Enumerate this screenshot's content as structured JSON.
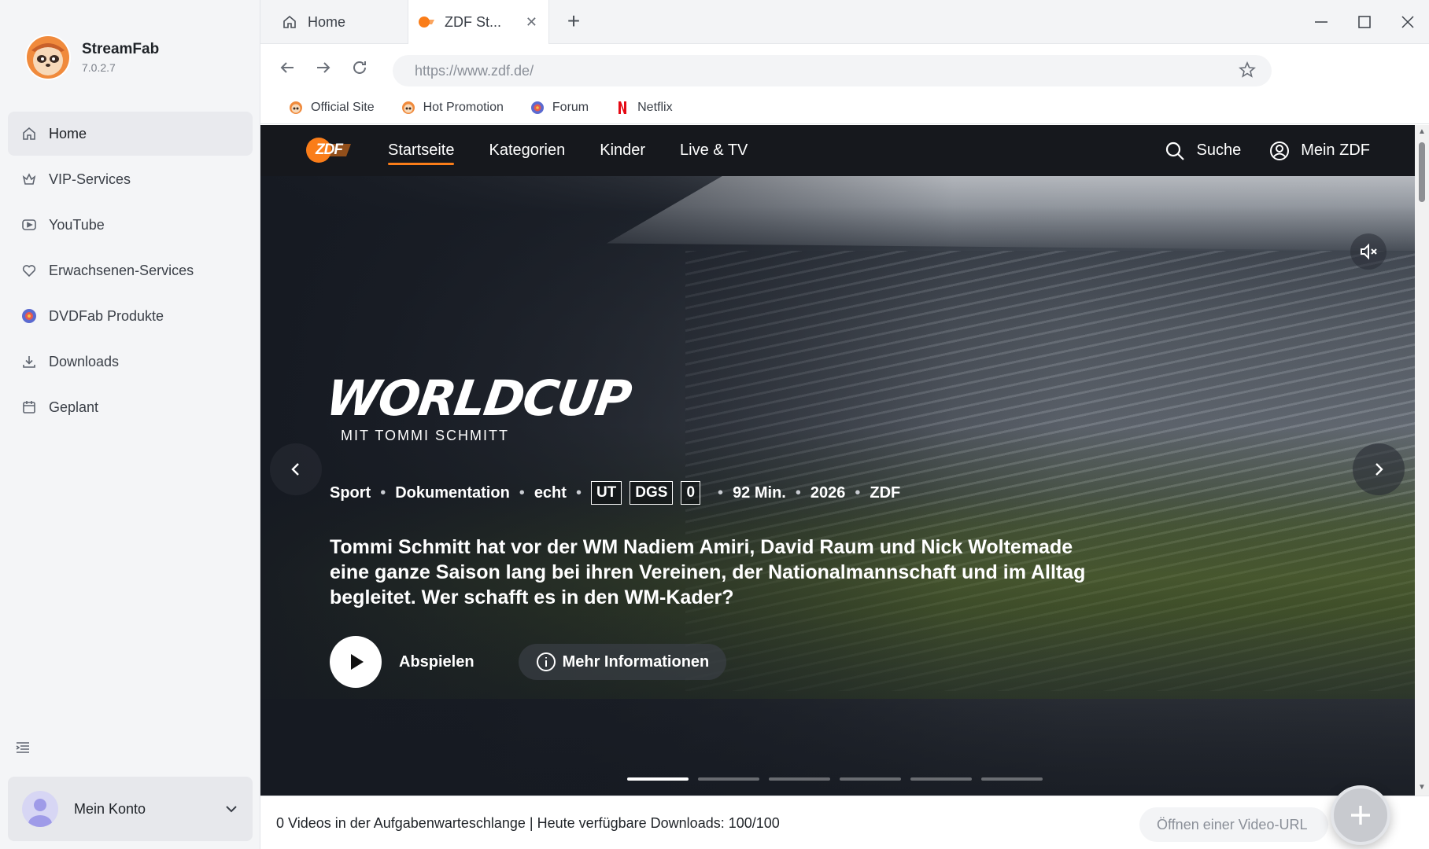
{
  "app": {
    "name": "StreamFab",
    "version": "7.0.2.7"
  },
  "sidebar": {
    "items": [
      {
        "label": "Home",
        "icon": "home-icon",
        "active": true
      },
      {
        "label": "VIP-Services",
        "icon": "vip-icon"
      },
      {
        "label": "YouTube",
        "icon": "youtube-icon"
      },
      {
        "label": "Erwachsenen-Services",
        "icon": "heart-icon"
      },
      {
        "label": "DVDFab Produkte",
        "icon": "dvdfab-icon"
      },
      {
        "label": "Downloads",
        "icon": "download-icon"
      },
      {
        "label": "Geplant",
        "icon": "calendar-icon"
      }
    ],
    "account_label": "Mein Konto"
  },
  "tabs": [
    {
      "label": "Home",
      "icon": "home-icon"
    },
    {
      "label": "ZDF St...",
      "icon": "zdf-icon",
      "active": true
    }
  ],
  "toolbar": {
    "url": "https://www.zdf.de/"
  },
  "bookmarks": [
    {
      "label": "Official Site",
      "icon": "streamfab-icon"
    },
    {
      "label": "Hot Promotion",
      "icon": "streamfab-icon"
    },
    {
      "label": "Forum",
      "icon": "dvdfab-icon"
    },
    {
      "label": "Netflix",
      "icon": "netflix-icon"
    }
  ],
  "zdf": {
    "logo_text": "ZDF",
    "nav": [
      {
        "label": "Startseite",
        "active": true
      },
      {
        "label": "Kategorien"
      },
      {
        "label": "Kinder"
      },
      {
        "label": "Live & TV"
      }
    ],
    "search_label": "Suche",
    "account_label": "Mein ZDF",
    "hero": {
      "logo_title": "WORLDCUP",
      "logo_subtitle": "MIT TOMMI SCHMITT",
      "meta": {
        "genre": "Sport",
        "type": "Dokumentation",
        "tag": "echt",
        "badges": [
          "UT",
          "DGS",
          "0"
        ],
        "duration": "92 Min.",
        "year": "2026",
        "channel": "ZDF"
      },
      "description": "Tommi Schmitt hat vor der WM Nadiem Amiri, David Raum und Nick Woltemade eine ganze Saison lang bei ihren Vereinen, der Nationalmannschaft und im Alltag begleitet. Wer schafft es in den WM-Kader?",
      "play_label": "Abspielen",
      "info_label": "Mehr Informationen",
      "slide_count": 6,
      "active_slide": 1
    },
    "accent_color": "#fa7d19"
  },
  "statusbar": {
    "queue_text": "0 Videos in der Aufgabenwarteschlange | Heute verfügbare Downloads: 100/100",
    "open_url_placeholder": "Öffnen einer Video-URL"
  }
}
